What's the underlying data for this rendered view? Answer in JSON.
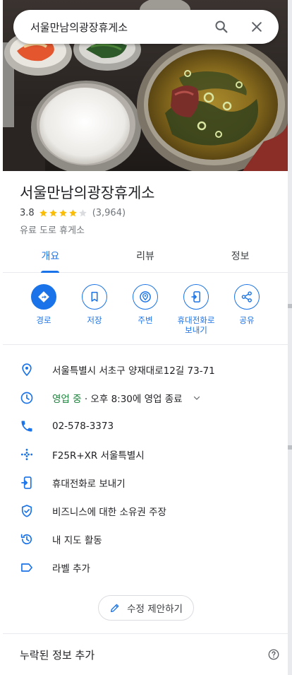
{
  "search": {
    "query": "서울만남의광장휴게소"
  },
  "place": {
    "name": "서울만남의광장휴게소",
    "rating": "3.8",
    "rating_value": 3.8,
    "review_count": "(3,964)",
    "category": "유료 도로 휴게소"
  },
  "tabs": [
    {
      "label": "개요",
      "active": true
    },
    {
      "label": "리뷰",
      "active": false
    },
    {
      "label": "정보",
      "active": false
    }
  ],
  "actions": [
    {
      "label": "경로",
      "icon": "directions-icon"
    },
    {
      "label": "저장",
      "icon": "bookmark-icon"
    },
    {
      "label": "주변",
      "icon": "nearby-icon"
    },
    {
      "label": "휴대전화로 보내기",
      "icon": "send-to-phone-icon"
    },
    {
      "label": "공유",
      "icon": "share-icon"
    }
  ],
  "info": {
    "address": "서울특별시 서초구 양재대로12길 73-71",
    "hours_status": "영업 중",
    "hours_detail": " · 오후 8:30에 영업 종료",
    "phone": "02-578-3373",
    "plus_code": "F25R+XR 서울특별시",
    "send_to_phone": "휴대전화로 보내기",
    "claim_business": "비즈니스에 대한 소유권 주장",
    "your_activity": "내 지도 활동",
    "add_label": "라벨 추가"
  },
  "suggest_edit": "수정 제안하기",
  "add_missing": "누락된 정보 추가",
  "colors": {
    "accent": "#1a73e8",
    "open_green": "#188038",
    "star": "#fbbc04"
  }
}
